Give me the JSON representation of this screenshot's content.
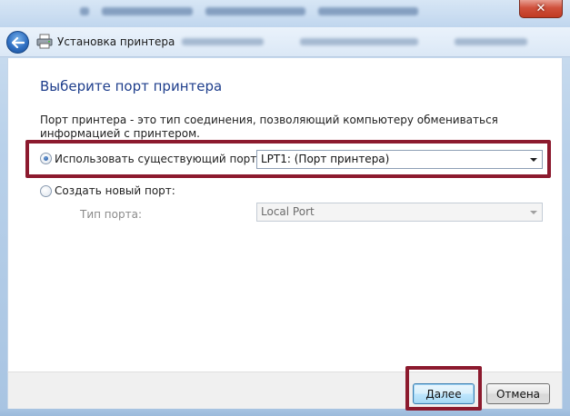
{
  "window": {
    "title": "Установка принтера",
    "close_glyph": "✕"
  },
  "page": {
    "heading": "Выберите порт принтера",
    "description": "Порт принтера - это тип соединения, позволяющий компьютеру обмениваться информацией с принтером."
  },
  "options": {
    "existing_port_label": "Использовать существующий порт:",
    "existing_port_value": "LPT1: (Порт принтера)",
    "new_port_label": "Создать новый порт:",
    "port_type_label": "Тип порта:",
    "port_type_value": "Local Port"
  },
  "buttons": {
    "next": "Далее",
    "cancel": "Отмена"
  },
  "colors": {
    "highlight": "#8c1a2e",
    "heading": "#1e3e8c"
  }
}
